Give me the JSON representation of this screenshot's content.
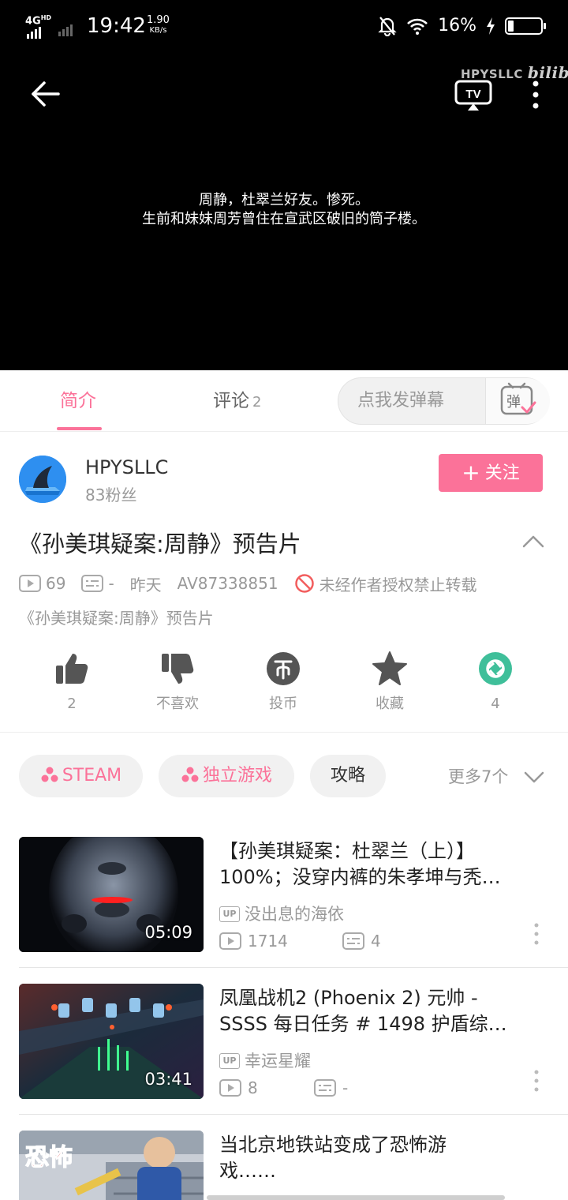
{
  "status_bar": {
    "network": "4G",
    "network_sup": "HD",
    "time": "19:42",
    "speed_value": "1.90",
    "speed_unit": "KB/s",
    "battery": "16%"
  },
  "player": {
    "watermark_text": "HPYSLLC",
    "watermark_logo": "bilibili",
    "tv_label": "TV",
    "subtitle_line1": "周静，杜翠兰好友。惨死。",
    "subtitle_line2": "生前和妹妹周芳曾住在宣武区破旧的筒子楼。"
  },
  "tabs": {
    "intro": "简介",
    "comments": "评论",
    "comments_count": "2",
    "danmu_placeholder": "点我发弹幕",
    "danmu_toggle": "弹"
  },
  "uploader": {
    "name": "HPYSLLC",
    "fans": "83粉丝",
    "follow_label": "关注",
    "follow_plus": "+"
  },
  "video": {
    "title": "《孙美琪疑案:周静》预告片",
    "views": "69",
    "danmaku": "-",
    "date": "昨天",
    "av_id": "AV87338851",
    "copyright": "未经作者授权禁止转载",
    "description": "《孙美琪疑案:周静》预告片"
  },
  "actions": {
    "like": "2",
    "dislike": "不喜欢",
    "coin": "投币",
    "favorite": "收藏",
    "share": "4"
  },
  "tags": {
    "items": [
      "STEAM",
      "独立游戏",
      "攻略"
    ],
    "more": "更多7个"
  },
  "related": [
    {
      "title_line1": "【孙美琪疑案：杜翠兰（上）】",
      "title_line2": "100%；没穿内裤的朱孝坤与秃…",
      "duration": "05:09",
      "up_badge": "UP",
      "uploader": "没出息的海依",
      "views": "1714",
      "danmaku": "4"
    },
    {
      "title_line1": "凤凰战机2 (Phoenix 2) 元帅 -",
      "title_line2": "SSSS 每日任务 # 1498 护盾综…",
      "duration": "03:41",
      "up_badge": "UP",
      "uploader": "幸运星耀",
      "views": "8",
      "danmaku": "-"
    },
    {
      "title_line1": "当北京地铁站变成了恐怖游",
      "title_line2": "戏……",
      "thumb_text": "恐怖"
    }
  ],
  "colors": {
    "accent": "#fb7299",
    "share_green": "#3fbf9a",
    "avatar_blue": "#2e8ff0"
  }
}
